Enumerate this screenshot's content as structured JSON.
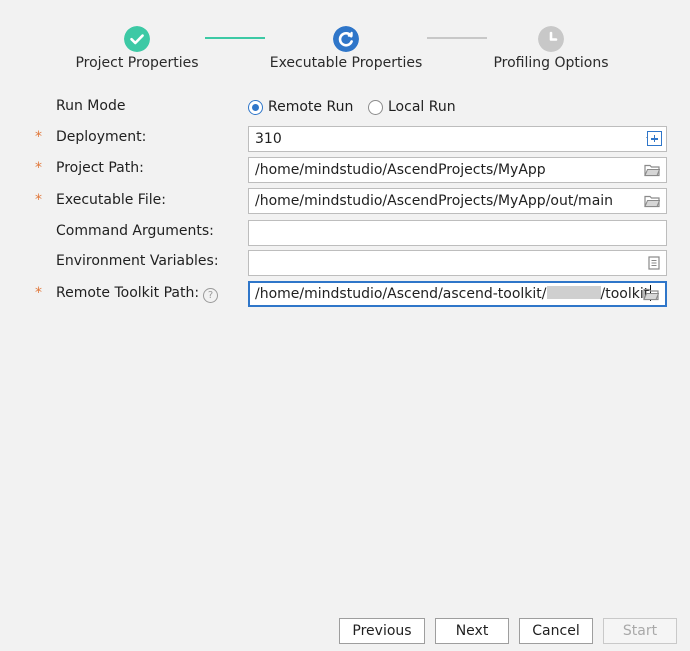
{
  "stepper": {
    "steps": [
      {
        "label": "Project Properties",
        "state": "completed",
        "icon": "check-icon",
        "color": "#3dc9a5"
      },
      {
        "label": "Executable Properties",
        "state": "current",
        "icon": "in-progress-icon",
        "color": "#2f76c9"
      },
      {
        "label": "Profiling Options",
        "state": "pending",
        "icon": "clock-icon",
        "color": "#c8c8c8"
      }
    ]
  },
  "form": {
    "run_mode": {
      "label": "Run Mode",
      "options": [
        "Remote Run",
        "Local Run"
      ],
      "selected": "Remote Run"
    },
    "deployment": {
      "label": "Deployment:",
      "value": "310",
      "required": true
    },
    "project_path": {
      "label": "Project Path:",
      "value": "/home/mindstudio/AscendProjects/MyApp",
      "required": true
    },
    "executable_file": {
      "label": "Executable File:",
      "value": "/home/mindstudio/AscendProjects/MyApp/out/main",
      "required": true
    },
    "command_arguments": {
      "label": "Command Arguments:",
      "value": ""
    },
    "environment_variables": {
      "label": "Environment Variables:",
      "value": ""
    },
    "remote_toolkit_path": {
      "label": "Remote Toolkit Path:",
      "value_prefix": "/home/mindstudio/Ascend/ascend-toolkit/",
      "value_suffix": "/toolkit",
      "required": true,
      "focused": true
    },
    "required_marker": "*"
  },
  "footer": {
    "previous_label": "Previous",
    "next_label": "Next",
    "cancel_label": "Cancel",
    "start_label": "Start",
    "start_disabled": true
  },
  "colors": {
    "accent": "#2f76c9",
    "success": "#3dc9a5",
    "required": "#e0773a",
    "background": "#f2f2f2"
  }
}
